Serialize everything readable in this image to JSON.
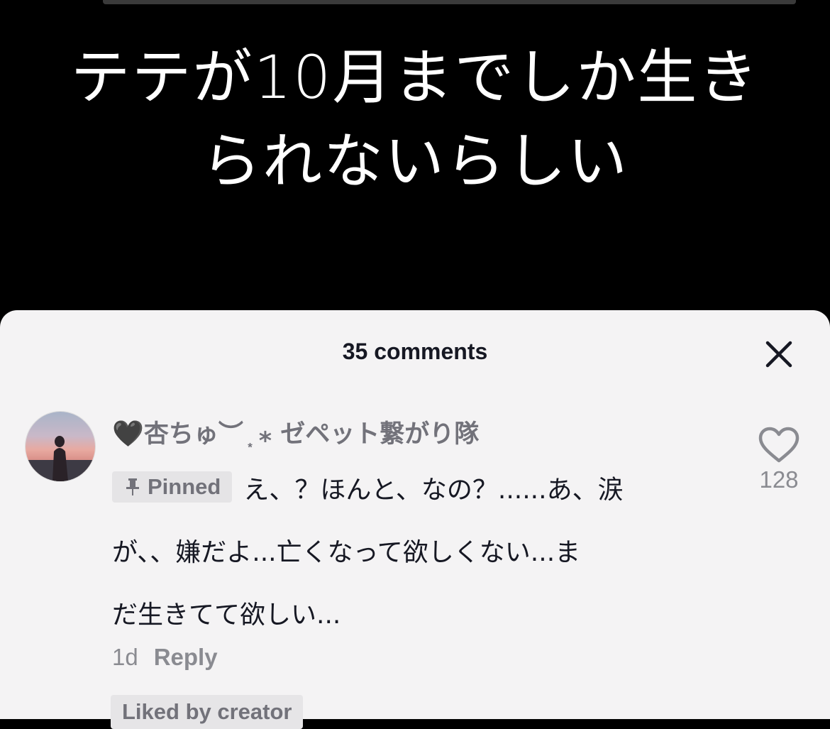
{
  "video": {
    "caption_line1": "テテが10月までしか生き",
    "caption_line2": "られないらしい"
  },
  "comments_sheet": {
    "title": "35 comments",
    "close_icon": "close-icon",
    "comment": {
      "username_heart": "🖤",
      "username": "杏ちゅ︶ ͙ ⁎ ゼペット繋がり隊",
      "pinned_label": "Pinned",
      "text_line1": "え、？ほんと、なの？......あ、涙",
      "text_line2": "が、、嫌だよ...亡くなって欲しくない...ま",
      "text_line3": "だ生きてて欲しい...",
      "time": "1d",
      "reply_label": "Reply",
      "liked_by_creator": "Liked by creator",
      "like_count": "128"
    }
  }
}
